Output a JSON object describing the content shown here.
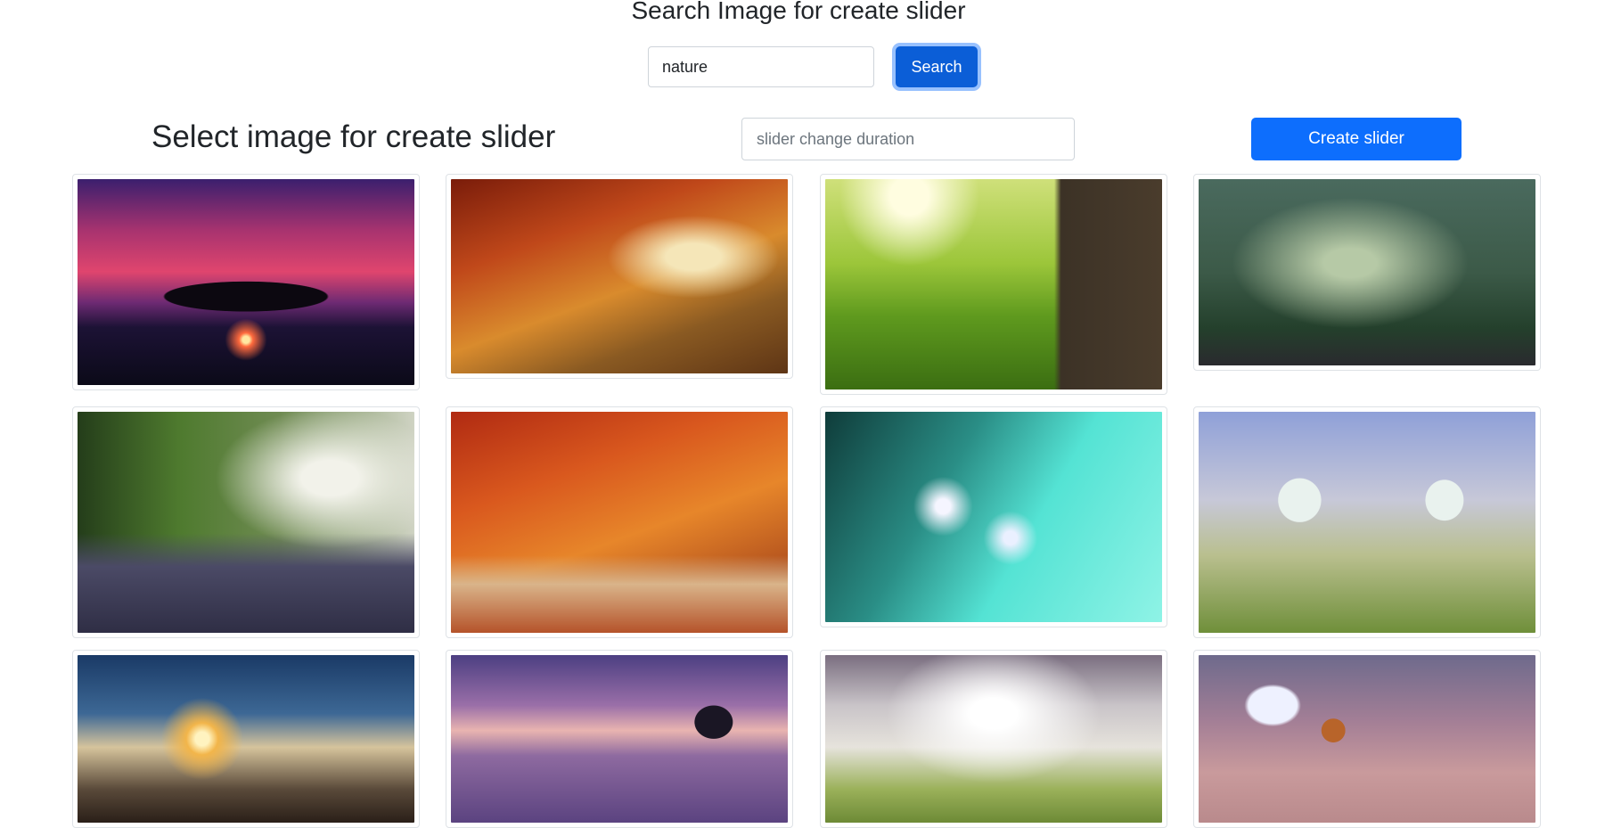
{
  "search": {
    "title": "Search Image for create slider",
    "query_value": "nature",
    "button_label": "Search"
  },
  "slider": {
    "title": "Select image for create slider",
    "duration_placeholder": "slider change duration",
    "create_label": "Create slider"
  },
  "colors": {
    "primary": "#0d6efd",
    "primary_active": "#0b5ed7",
    "text": "#212529",
    "border": "#dee2e6"
  }
}
